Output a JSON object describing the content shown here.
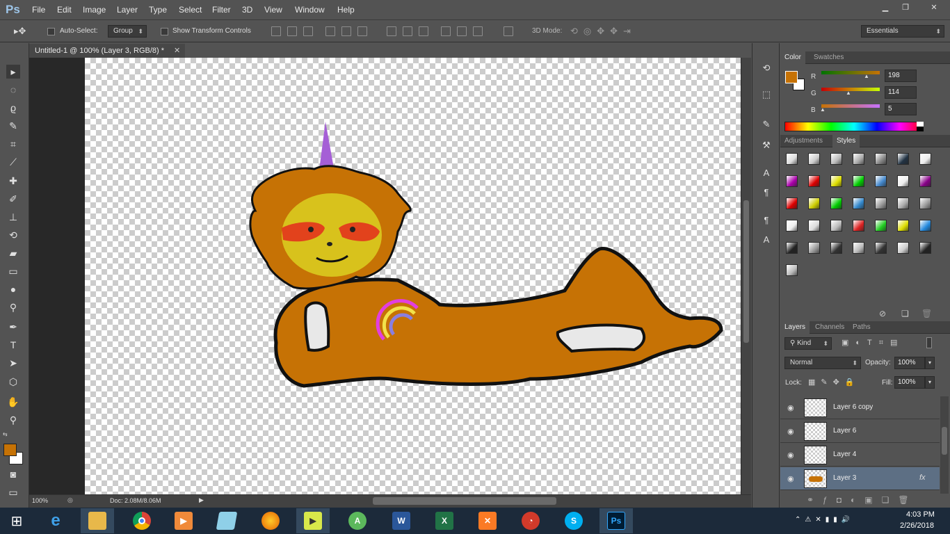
{
  "app": {
    "logo": "Ps"
  },
  "menu": [
    "File",
    "Edit",
    "Image",
    "Layer",
    "Type",
    "Select",
    "Filter",
    "3D",
    "View",
    "Window",
    "Help"
  ],
  "options": {
    "auto_select_label": "Auto-Select:",
    "auto_select_value": "Group",
    "show_transform_label": "Show Transform Controls",
    "mode3d_label": "3D Mode:",
    "workspace": "Essentials"
  },
  "document": {
    "tab_title": "Untitled-1 @ 100% (Layer 3, RGB/8) *",
    "zoom": "100%",
    "doc_info": "Doc: 2.08M/8.06M"
  },
  "colors": {
    "foreground": "#c67205",
    "background": "#ffffff"
  },
  "color_panel": {
    "tabs": [
      "Color",
      "Swatches"
    ],
    "channels": [
      {
        "label": "R",
        "value": "198"
      },
      {
        "label": "G",
        "value": "114"
      },
      {
        "label": "B",
        "value": "5"
      }
    ]
  },
  "styles_panel": {
    "tabs": [
      "Adjustments",
      "Styles"
    ]
  },
  "layers_panel": {
    "tabs": [
      "Layers",
      "Channels",
      "Paths"
    ],
    "kind_label": "Kind",
    "blend_mode": "Normal",
    "opacity_label": "Opacity:",
    "opacity_value": "100%",
    "lock_label": "Lock:",
    "fill_label": "Fill:",
    "fill_value": "100%",
    "layers": [
      {
        "name": "Layer 6 copy",
        "selected": false
      },
      {
        "name": "Layer 6",
        "selected": false
      },
      {
        "name": "Layer 4",
        "selected": false
      },
      {
        "name": "Layer 3",
        "selected": true,
        "fx": "fx"
      }
    ]
  },
  "taskbar": {
    "time": "4:03 PM",
    "date": "2/26/2018",
    "apps": [
      "internet-explorer",
      "file-explorer",
      "chrome",
      "media-player",
      "notes",
      "firefox",
      "presentation",
      "android-studio",
      "word",
      "excel",
      "xampp",
      "git-tool",
      "skype",
      "photoshop"
    ]
  }
}
